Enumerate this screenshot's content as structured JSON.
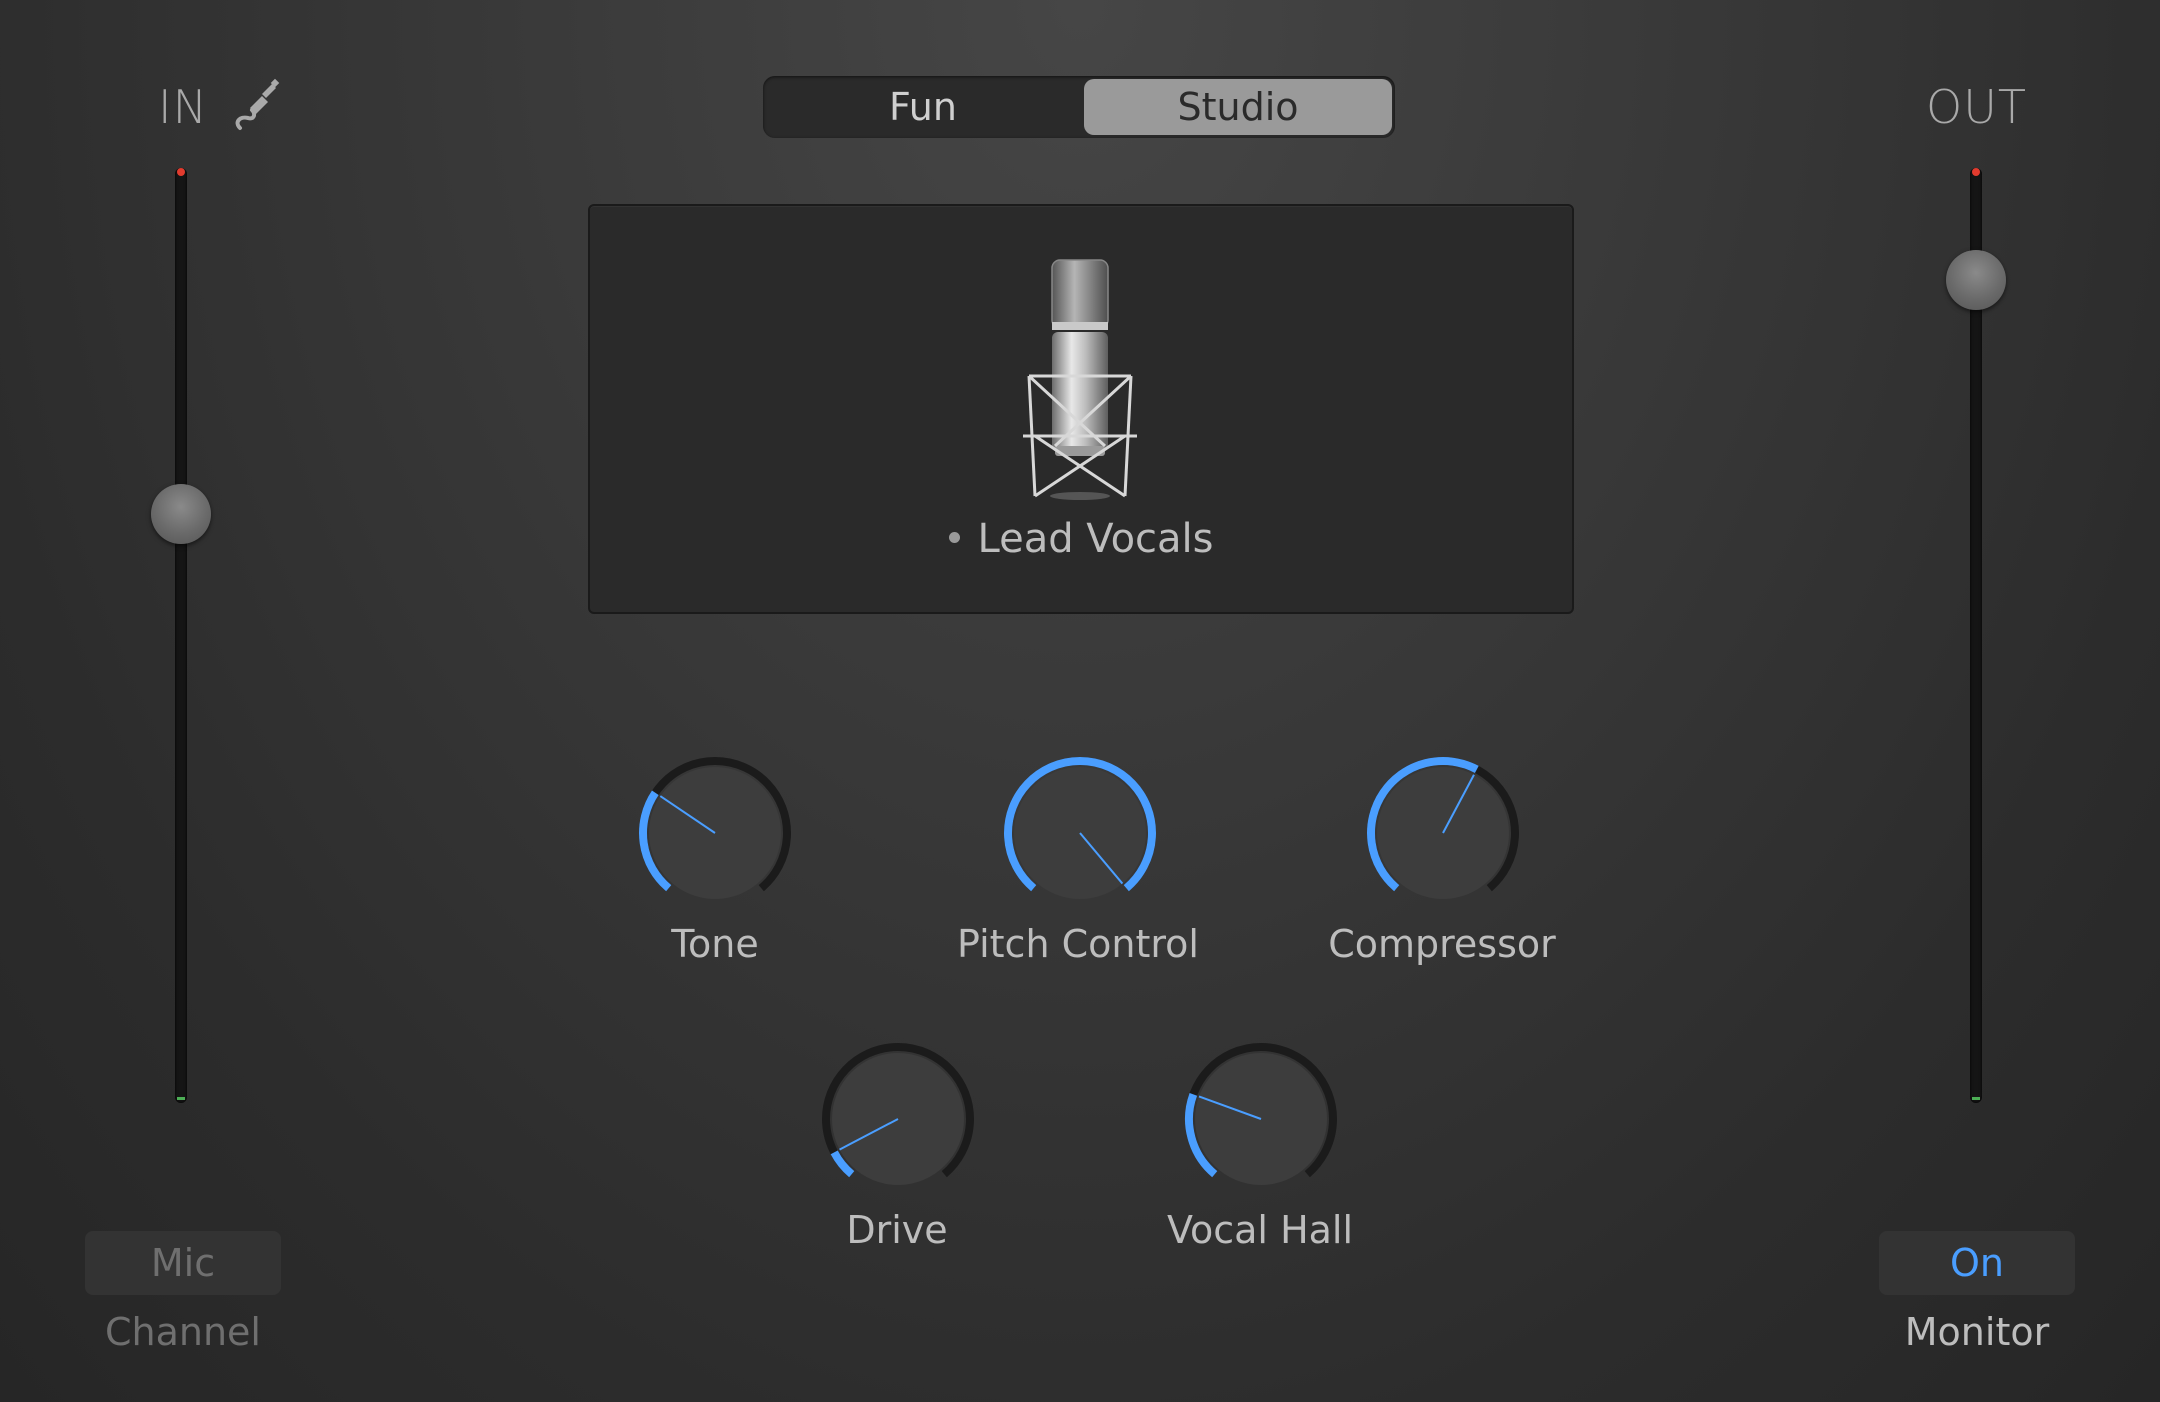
{
  "input": {
    "label": "IN",
    "icon": "guitar-cable-icon",
    "level": 0.63
  },
  "output": {
    "label": "OUT",
    "level": 0.88
  },
  "mode_tabs": [
    {
      "label": "Fun",
      "selected": false
    },
    {
      "label": "Studio",
      "selected": true
    }
  ],
  "preset": {
    "name": "Lead Vocals",
    "icon": "condenser-microphone-icon"
  },
  "knobs": {
    "tone": {
      "label": "Tone",
      "value": 0.3
    },
    "pitch_control": {
      "label": "Pitch Control",
      "value": 1.0
    },
    "compressor": {
      "label": "Compressor",
      "value": 0.6
    },
    "drive": {
      "label": "Drive",
      "value": 0.08
    },
    "vocal_hall": {
      "label": "Vocal Hall",
      "value": 0.25
    }
  },
  "channel": {
    "button_label": "Mic",
    "caption": "Channel"
  },
  "monitor": {
    "button_label": "On",
    "caption": "Monitor"
  },
  "colors": {
    "accent": "#4a9eff",
    "background": "#333333",
    "knob_track": "#1b1b1b"
  }
}
